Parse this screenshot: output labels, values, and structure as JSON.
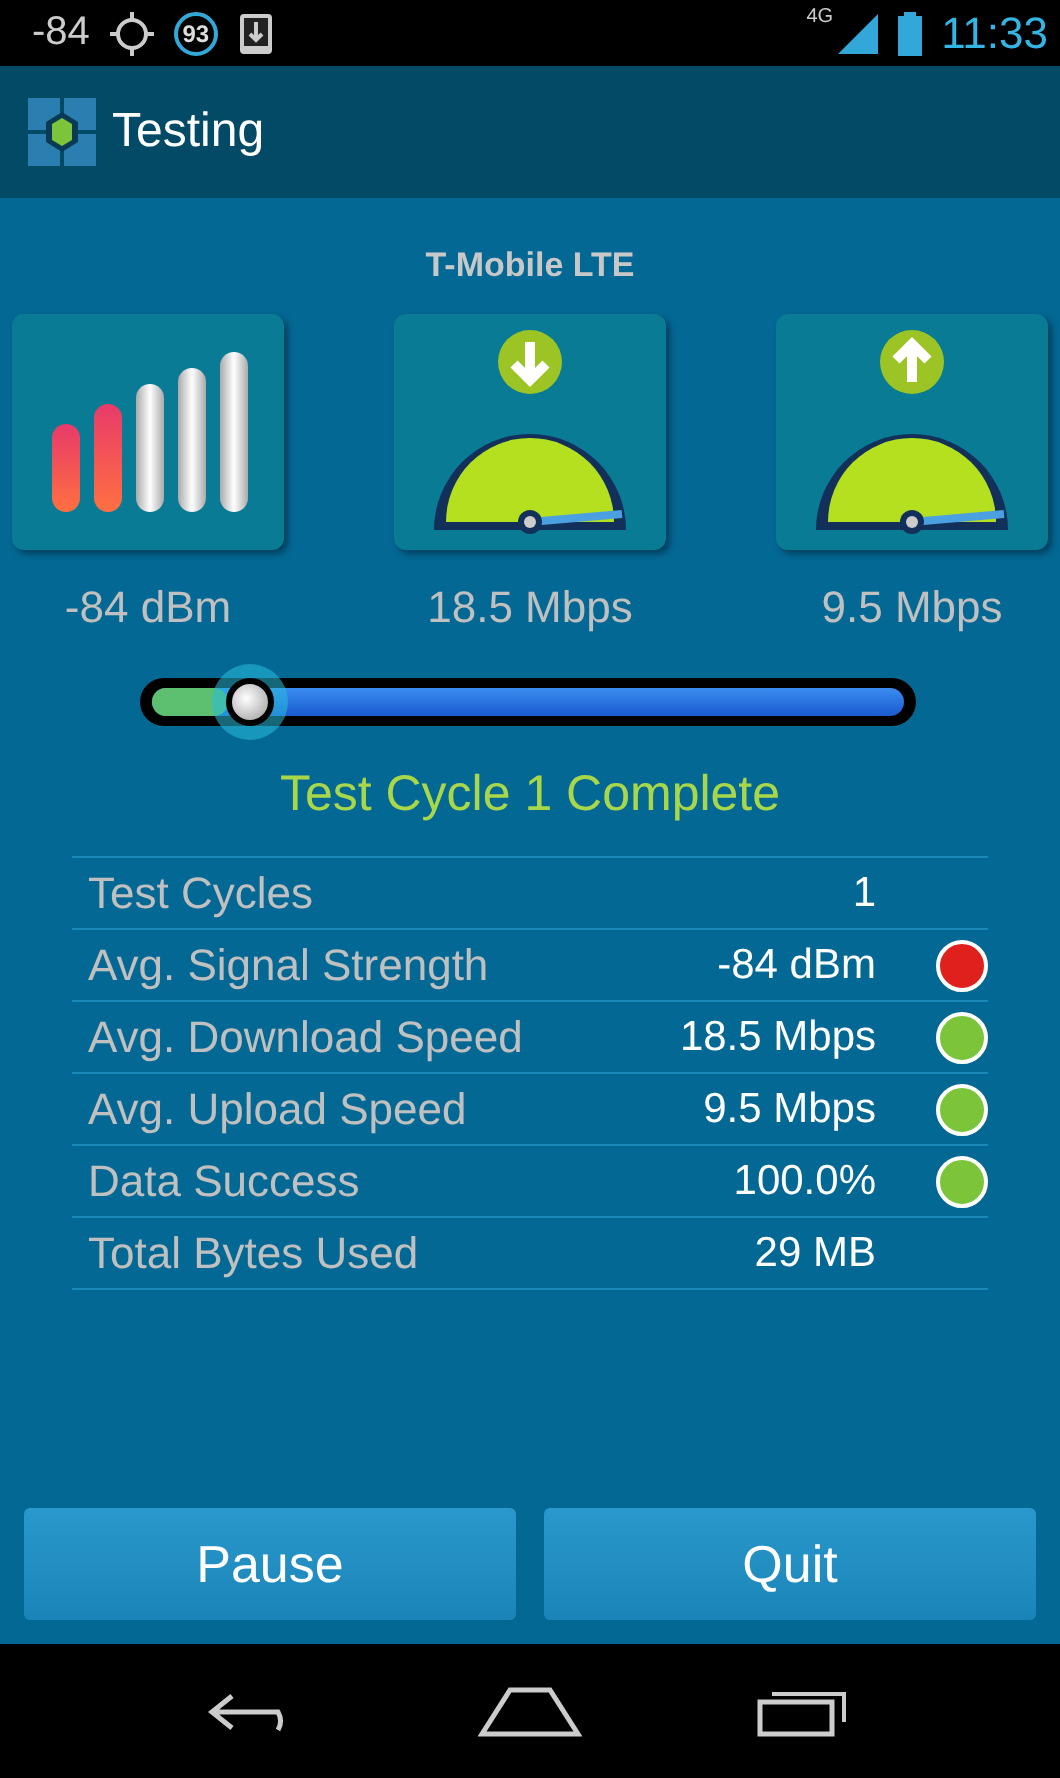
{
  "status_bar": {
    "signal_reading": "-84",
    "badge": "93",
    "network": "4G",
    "time": "11:33"
  },
  "action_bar": {
    "title": "Testing"
  },
  "network_name": "T-Mobile LTE",
  "tiles": [
    {
      "kind": "signal",
      "reading": "-84 dBm"
    },
    {
      "kind": "download",
      "reading": "18.5 Mbps"
    },
    {
      "kind": "upload",
      "reading": "9.5 Mbps"
    }
  ],
  "progress": {
    "level": 0.1
  },
  "status_message": "Test Cycle 1 Complete",
  "results": [
    {
      "label": "Test Cycles",
      "value": "1"
    },
    {
      "label": "Avg. Signal Strength",
      "value": "-84 dBm",
      "color": "#e0201c"
    },
    {
      "label": "Avg. Download Speed",
      "value": "18.5 Mbps",
      "color": "#7cc43a"
    },
    {
      "label": "Avg. Upload Speed",
      "value": "9.5 Mbps",
      "color": "#7cc43a"
    },
    {
      "label": "Data Success",
      "value": "100.0%",
      "color": "#7cc43a"
    },
    {
      "label": "Total Bytes Used",
      "value": "29 MB"
    }
  ],
  "buttons": [
    "Pause",
    "Quit"
  ]
}
